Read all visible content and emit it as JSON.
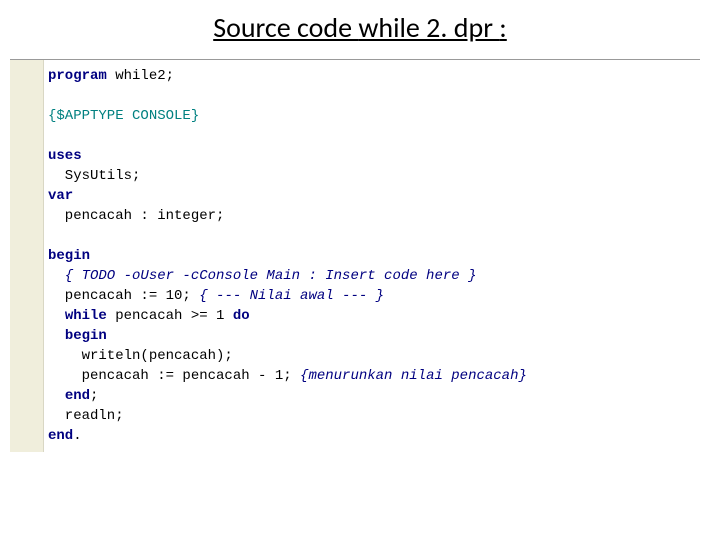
{
  "title": {
    "prefix": "Source code ",
    "filename": "while 2. dpr ",
    "suffix": ":"
  },
  "code": {
    "l1_kw": "program",
    "l1_rest": " while2;",
    "l2_blank": "",
    "l3_dir": "{$APPTYPE CONSOLE}",
    "l4_blank": "",
    "l5_kw": "uses",
    "l6": "  SysUtils;",
    "l7_kw": "var",
    "l8": "  pencacah : integer;",
    "l9_blank": "",
    "l10_kw": "begin",
    "l11_cmt": "  { TODO -oUser -cConsole Main : Insert code here }",
    "l12_a": "  pencacah := 10; ",
    "l12_cmt": "{ --- Nilai awal --- }",
    "l13_a": "  ",
    "l13_kw1": "while",
    "l13_b": " pencacah >= 1 ",
    "l13_kw2": "do",
    "l14_a": "  ",
    "l14_kw": "begin",
    "l15": "    writeln(pencacah);",
    "l16_a": "    pencacah := pencacah - 1; ",
    "l16_cmt": "{menurunkan nilai pencacah}",
    "l17_a": "  ",
    "l17_kw": "end",
    "l17_b": ";",
    "l18": "  readln;",
    "l19_kw": "end",
    "l19_b": "."
  }
}
